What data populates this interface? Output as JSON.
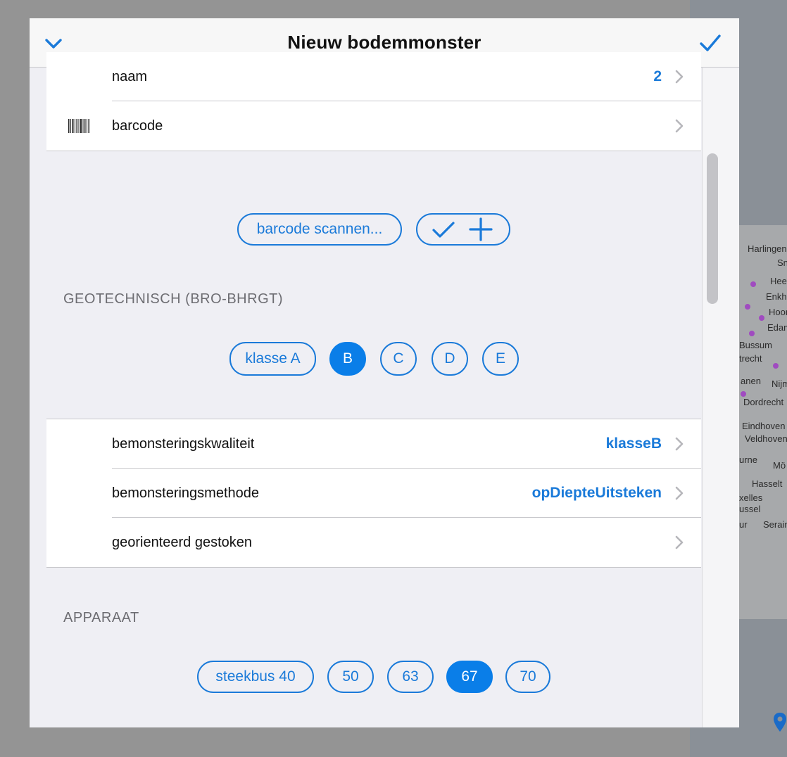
{
  "nav": {
    "title": "Nieuw bodemmonster",
    "dismiss_icon": "chevron-down-icon",
    "confirm_icon": "checkmark-icon"
  },
  "top_rows": [
    {
      "label": "naam",
      "value": "2"
    },
    {
      "label": "barcode",
      "value": "",
      "icon": "barcode-icon"
    }
  ],
  "scan_actions": {
    "scan_label": "barcode scannen...",
    "confirm_add_icons": [
      "checkmark-icon",
      "plus-icon"
    ]
  },
  "geotechnisch": {
    "title": "GEOTECHNISCH (BRO-BHRGT)",
    "classes": [
      "klasse A",
      "B",
      "C",
      "D",
      "E"
    ],
    "selected": "B"
  },
  "sample_rows": [
    {
      "label": "bemonsteringskwaliteit",
      "value": "klasseB"
    },
    {
      "label": "bemonsteringsmethode",
      "value": "opDiepteUitsteken"
    },
    {
      "label": "georienteerd gestoken",
      "value": ""
    }
  ],
  "apparaat": {
    "title": "APPARAAT",
    "options": [
      "steekbus 40",
      "50",
      "63",
      "67",
      "70"
    ],
    "selected": "67"
  },
  "map_labels": [
    "Harlingen",
    "Sn",
    "Hee",
    "Enkhui",
    "Hoorn",
    "Edam",
    "Bussum",
    "trecht",
    "anen",
    "Nijm",
    "Dordrecht",
    "Eindhoven",
    "Veldhoven",
    "urne",
    "Mö",
    "Hasselt",
    "xelles",
    "ussel",
    "ur",
    "Serain"
  ],
  "colors": {
    "accent": "#1a7ad9",
    "selected_fill": "#0a7ee8",
    "background": "#efeff4"
  }
}
